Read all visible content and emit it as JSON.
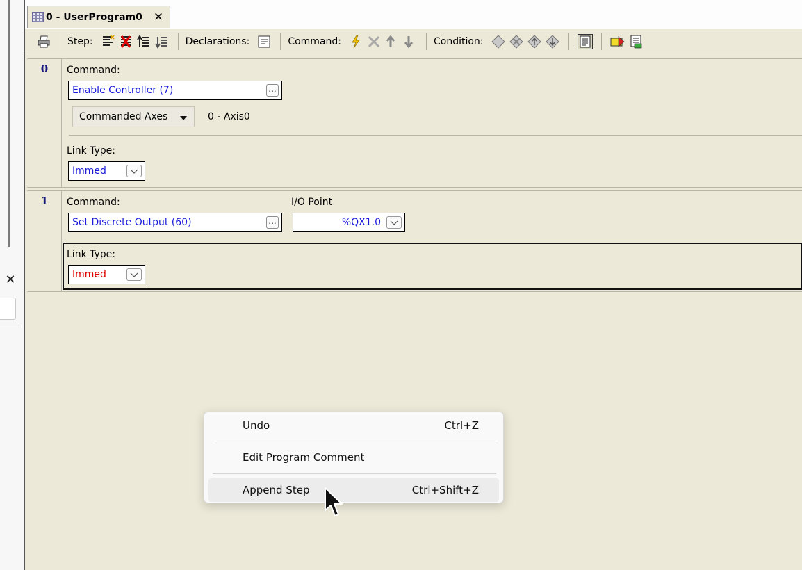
{
  "tab": {
    "title": "0 - UserProgram0",
    "close": "✕"
  },
  "toolbar": {
    "step_label": "Step:",
    "declarations_label": "Declarations:",
    "command_label": "Command:",
    "condition_label": "Condition:"
  },
  "steps": [
    {
      "number": "0",
      "command_label": "Command:",
      "command_value": "Enable Controller (7)",
      "commanded_axes_label": "Commanded Axes",
      "axis_value": "0 - Axis0",
      "link_type_label": "Link Type:",
      "link_type_value": "Immed"
    },
    {
      "number": "1",
      "command_label": "Command:",
      "command_value": "Set Discrete Output (60)",
      "io_point_label": "I/O Point",
      "io_point_value": "%QX1.0",
      "link_type_label": "Link Type:",
      "link_type_value": "Immed"
    }
  ],
  "context_menu": {
    "items": [
      {
        "label": "Undo",
        "shortcut": "Ctrl+Z"
      },
      {
        "label": "Edit Program Comment",
        "shortcut": ""
      },
      {
        "label": "Append Step",
        "shortcut": "Ctrl+Shift+Z"
      }
    ]
  },
  "left_panel": {
    "close": "✕"
  },
  "ellipsis": "...",
  "colors": {
    "value_blue": "#1a1adb",
    "error_red": "#e00000",
    "panel_bg": "#ece9d8"
  }
}
